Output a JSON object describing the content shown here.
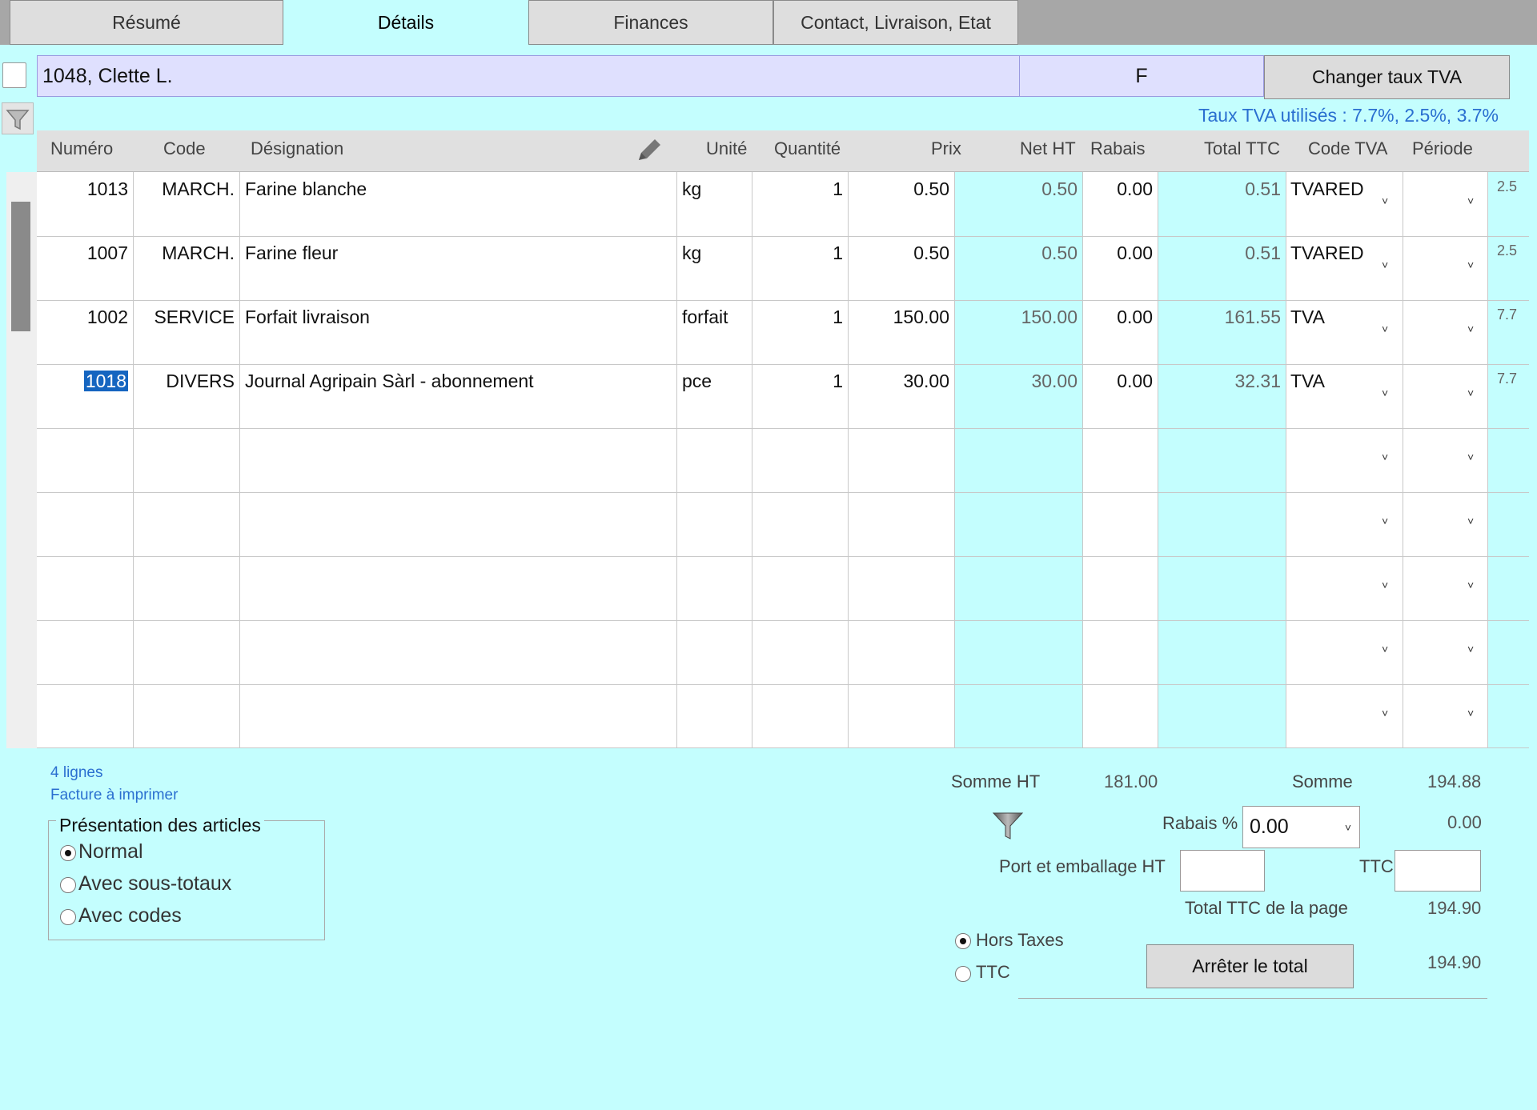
{
  "tabs": [
    {
      "label": "Résumé"
    },
    {
      "label": "Détails"
    },
    {
      "label": "Finances"
    },
    {
      "label": "Contact, Livraison, Etat"
    }
  ],
  "header": {
    "client": "1048, Clette L.",
    "type": "F",
    "change_vat_button": "Changer taux TVA",
    "vat_rates_used": "Taux TVA utilisés : 7.7%, 2.5%, 3.7%"
  },
  "columns": {
    "numero": "Numéro",
    "code": "Code",
    "designation": "Désignation",
    "unite": "Unité",
    "quantite": "Quantité",
    "prix": "Prix",
    "net_ht": "Net HT",
    "rabais": "Rabais",
    "total_ttc": "Total TTC",
    "code_tva": "Code TVA",
    "periode": "Période"
  },
  "rows": [
    {
      "numero": "1013",
      "code": "MARCH.",
      "designation": "Farine blanche",
      "unite": "kg",
      "quantite": "1",
      "prix": "0.50",
      "net_ht": "0.50",
      "rabais": "0.00",
      "total_ttc": "0.51",
      "code_tva": "TVARED",
      "taux": "2.5"
    },
    {
      "numero": "1007",
      "code": "MARCH.",
      "designation": "Farine fleur",
      "unite": "kg",
      "quantite": "1",
      "prix": "0.50",
      "net_ht": "0.50",
      "rabais": "0.00",
      "total_ttc": "0.51",
      "code_tva": "TVARED",
      "taux": "2.5"
    },
    {
      "numero": "1002",
      "code": "SERVICE",
      "designation": "Forfait livraison",
      "unite": "forfait",
      "quantite": "1",
      "prix": "150.00",
      "net_ht": "150.00",
      "rabais": "0.00",
      "total_ttc": "161.55",
      "code_tva": "TVA",
      "taux": "7.7"
    },
    {
      "numero": "1018",
      "code": "DIVERS",
      "designation": "Journal Agripain Sàrl - abonnement",
      "unite": "pce",
      "quantite": "1",
      "prix": "30.00",
      "net_ht": "30.00",
      "rabais": "0.00",
      "total_ttc": "32.31",
      "code_tva": "TVA",
      "taux": "7.7"
    }
  ],
  "dropdown_glyph": "˅",
  "footer": {
    "line_count": "4 lignes",
    "invoice_status": "Facture à imprimer",
    "presentation_legend": "Présentation des articles",
    "presentation_options": [
      "Normal",
      "Avec sous-totaux",
      "Avec codes"
    ],
    "somme_ht_label": "Somme HT",
    "somme_ht_value": "181.00",
    "somme_label": "Somme",
    "somme_value": "194.88",
    "rabais_label": "Rabais %",
    "rabais_value": "0.00",
    "rabais_amount": "0.00",
    "port_label": "Port et emballage HT",
    "ttc_label": "TTC",
    "total_page_label": "Total TTC de la page",
    "total_page_value": "194.90",
    "mode_options": [
      "Hors Taxes",
      "TTC"
    ],
    "stop_total_button": "Arrêter le total",
    "final_total": "194.90"
  }
}
